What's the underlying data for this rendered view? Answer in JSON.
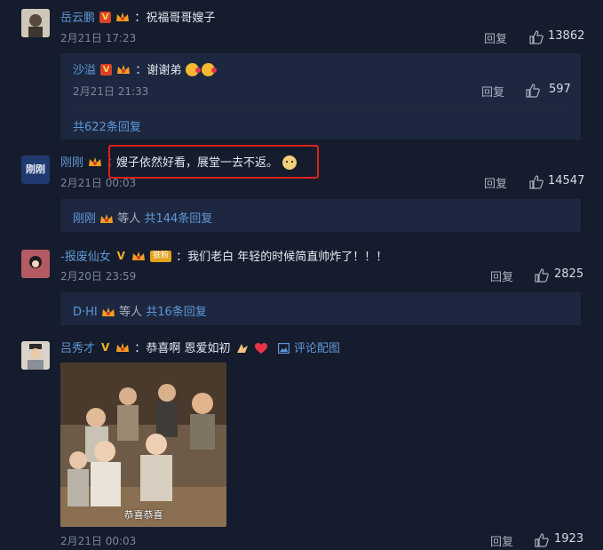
{
  "comments": [
    {
      "user": "岳云鹏",
      "text": "祝福哥哥嫂子",
      "time": "2月21日 17:23",
      "reply_label": "回复",
      "likes": "13862",
      "sub_reply": {
        "user": "沙溢",
        "text": "谢谢弟",
        "time": "2月21日 21:33",
        "reply_label": "回复",
        "likes": "597"
      },
      "more_replies": "共622条回复"
    },
    {
      "user": "刚刚",
      "avatar_text": "刚刚",
      "text": "嫂子依然好看，展堂一去不返。",
      "time": "2月21日 00:03",
      "reply_label": "回复",
      "likes": "14547",
      "summary_user": "刚刚",
      "summary_mid": "等人",
      "summary_count": "共144条回复"
    },
    {
      "user": "-报废仙女",
      "badge_text": "铁粉",
      "text": "我们老白 年轻的时候简直帅炸了！！！",
      "time": "2月20日 23:59",
      "reply_label": "回复",
      "likes": "2825",
      "summary_user": "D·HI",
      "summary_mid": "等人",
      "summary_count": "共16条回复"
    },
    {
      "user": "吕秀才",
      "text": "恭喜啊 恩爱如初",
      "image_link": "评论配图",
      "image_caption": "恭喜恭喜",
      "time": "2月21日 00:03",
      "reply_label": "回复",
      "likes": "1923"
    }
  ],
  "colors": {
    "background": "#151c2d",
    "username": "#5f97d6",
    "highlight_box": "#e0201b"
  }
}
